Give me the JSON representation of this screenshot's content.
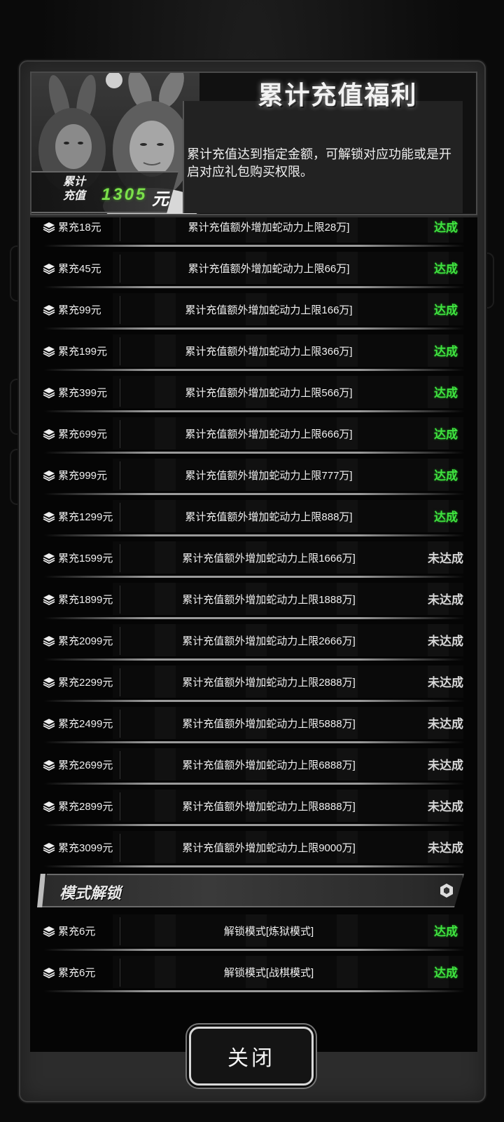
{
  "header": {
    "title": "累计充值福利",
    "description": "累计充值达到指定金额，可解锁对应功能或是开启对应礼包购买权限。",
    "recharge_label_line1": "累计",
    "recharge_label_line2": "充值",
    "recharge_amount": "1305",
    "recharge_unit": "元"
  },
  "icons": {
    "row_icon": "stack-layers-icon",
    "section_icon": "hexagon-icon"
  },
  "colors": {
    "done": "#3fe23f",
    "not_done": "#d8d8d8",
    "amount": "#7be04a"
  },
  "rows": [
    {
      "threshold": "累充18元",
      "reward": "累计充值额外增加蛇动力上限28万]",
      "status": "达成"
    },
    {
      "threshold": "累充45元",
      "reward": "累计充值额外增加蛇动力上限66万]",
      "status": "达成"
    },
    {
      "threshold": "累充99元",
      "reward": "累计充值额外增加蛇动力上限166万]",
      "status": "达成"
    },
    {
      "threshold": "累充199元",
      "reward": "累计充值额外增加蛇动力上限366万]",
      "status": "达成"
    },
    {
      "threshold": "累充399元",
      "reward": "累计充值额外增加蛇动力上限566万]",
      "status": "达成"
    },
    {
      "threshold": "累充699元",
      "reward": "累计充值额外增加蛇动力上限666万]",
      "status": "达成"
    },
    {
      "threshold": "累充999元",
      "reward": "累计充值额外增加蛇动力上限777万]",
      "status": "达成"
    },
    {
      "threshold": "累充1299元",
      "reward": "累计充值额外增加蛇动力上限888万]",
      "status": "达成"
    },
    {
      "threshold": "累充1599元",
      "reward": "累计充值额外增加蛇动力上限1666万]",
      "status": "未达成"
    },
    {
      "threshold": "累充1899元",
      "reward": "累计充值额外增加蛇动力上限1888万]",
      "status": "未达成"
    },
    {
      "threshold": "累充2099元",
      "reward": "累计充值额外增加蛇动力上限2666万]",
      "status": "未达成"
    },
    {
      "threshold": "累充2299元",
      "reward": "累计充值额外增加蛇动力上限2888万]",
      "status": "未达成"
    },
    {
      "threshold": "累充2499元",
      "reward": "累计充值额外增加蛇动力上限5888万]",
      "status": "未达成"
    },
    {
      "threshold": "累充2699元",
      "reward": "累计充值额外增加蛇动力上限6888万]",
      "status": "未达成"
    },
    {
      "threshold": "累充2899元",
      "reward": "累计充值额外增加蛇动力上限8888万]",
      "status": "未达成"
    },
    {
      "threshold": "累充3099元",
      "reward": "累计充值额外增加蛇动力上限9000万]",
      "status": "未达成"
    }
  ],
  "section": {
    "title": "模式解锁"
  },
  "mode_rows": [
    {
      "threshold": "累充6元",
      "reward": "解锁模式[炼狱模式]",
      "status": "达成"
    },
    {
      "threshold": "累充6元",
      "reward": "解锁模式[战棋模式]",
      "status": "达成"
    }
  ],
  "close_button": {
    "label": "关闭"
  }
}
